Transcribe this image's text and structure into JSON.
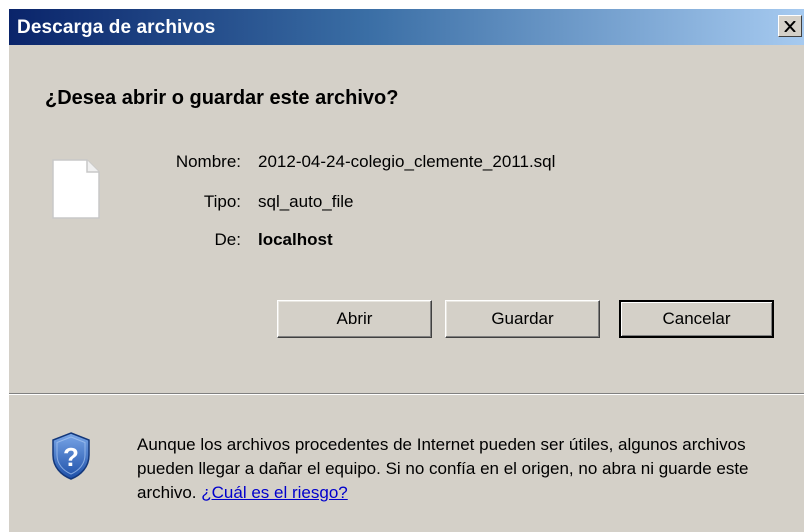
{
  "window": {
    "title": "Descarga de archivos",
    "close_glyph": "×",
    "titlebar_colors": [
      "#0a246a",
      "#3a6ea5",
      "#a6caf0"
    ],
    "background": "#d4d0c8"
  },
  "prompt": {
    "heading": "¿Desea abrir o guardar este archivo?"
  },
  "file": {
    "icon": "document-icon",
    "name_label": "Nombre:",
    "name_value": "2012-04-24-colegio_clemente_2011.sql",
    "type_label": "Tipo:",
    "type_value": "sql_auto_file",
    "from_label": "De:",
    "from_value": "localhost"
  },
  "buttons": {
    "open": "Abrir",
    "save": "Guardar",
    "cancel": "Cancelar"
  },
  "warning": {
    "icon": "shield-help-icon",
    "text": "Aunque los archivos procedentes de Internet pueden ser útiles, algunos archivos pueden llegar a dañar el equipo. Si no confía en el origen, no abra ni guarde este archivo.",
    "link": "¿Cuál es el riesgo?",
    "link_color": "#0000cc"
  }
}
